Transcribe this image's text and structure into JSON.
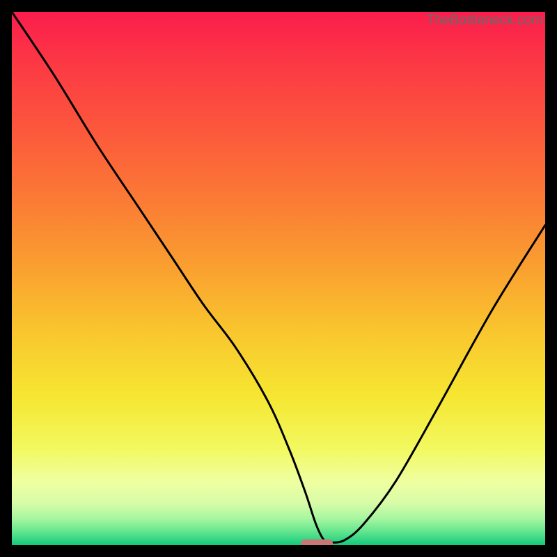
{
  "attribution": "TheBottleneck.com",
  "chart_data": {
    "type": "line",
    "title": "",
    "xlabel": "",
    "ylabel": "",
    "xlim": [
      0,
      100
    ],
    "ylim": [
      0,
      100
    ],
    "background": "vertical-heatmap",
    "series": [
      {
        "name": "bottleneck-curve",
        "x": [
          0,
          8,
          16,
          24,
          30,
          36,
          42,
          48,
          52,
          55,
          57,
          58.5,
          60,
          62.5,
          66,
          72,
          80,
          90,
          100
        ],
        "y": [
          100,
          88,
          75,
          63,
          54,
          45,
          37,
          27,
          18,
          10,
          4,
          1,
          0.5,
          1,
          4,
          12,
          26,
          44,
          60
        ]
      }
    ],
    "marker": {
      "name": "optimal-zone",
      "shape": "rounded-pill",
      "x": 57.2,
      "y": 0.3,
      "width_pct": 6.0,
      "height_pct": 1.6,
      "color": "#c77874"
    },
    "gradient_stops": [
      {
        "pos": 0.0,
        "color": "#fb1d4d"
      },
      {
        "pos": 0.1,
        "color": "#fc3944"
      },
      {
        "pos": 0.22,
        "color": "#fc573c"
      },
      {
        "pos": 0.35,
        "color": "#fb7a35"
      },
      {
        "pos": 0.48,
        "color": "#faa030"
      },
      {
        "pos": 0.6,
        "color": "#f9c62e"
      },
      {
        "pos": 0.72,
        "color": "#f6e631"
      },
      {
        "pos": 0.82,
        "color": "#f2f960"
      },
      {
        "pos": 0.88,
        "color": "#efffa0"
      },
      {
        "pos": 0.92,
        "color": "#d9fca8"
      },
      {
        "pos": 0.95,
        "color": "#a7f6a0"
      },
      {
        "pos": 0.975,
        "color": "#62e58e"
      },
      {
        "pos": 1.0,
        "color": "#12c97d"
      }
    ]
  }
}
